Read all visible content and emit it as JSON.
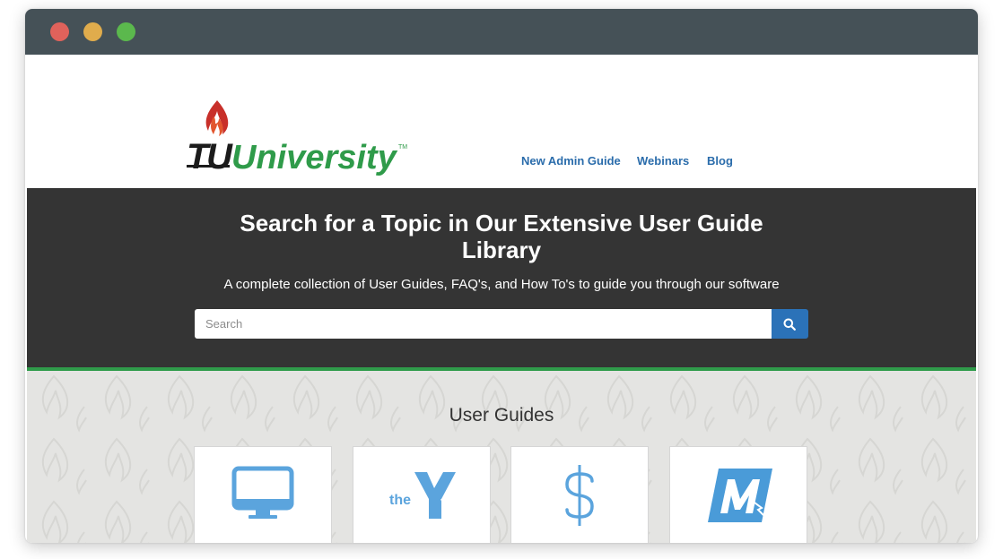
{
  "browser": {
    "buttons": [
      "close",
      "minimize",
      "maximize"
    ]
  },
  "header": {
    "logo_text": "TU University",
    "logo_tm": "TM",
    "nav": [
      {
        "label": "New Admin Guide"
      },
      {
        "label": "Webinars"
      },
      {
        "label": "Blog"
      }
    ]
  },
  "hero": {
    "title_line1": "Search for a Topic in Our Extensive User Guide",
    "title_line2": "Library",
    "subtitle": "A complete collection of User Guides, FAQ's, and How To's to guide you through our software",
    "search_placeholder": "Search",
    "search_icon": "search-icon"
  },
  "user_guides": {
    "title": "User Guides",
    "cards": [
      {
        "icon": "monitor-icon"
      },
      {
        "icon": "ymca-logo-icon",
        "text": "the"
      },
      {
        "icon": "dollar-icon"
      },
      {
        "icon": "m-logo-icon"
      }
    ]
  },
  "colors": {
    "titlebar": "#455157",
    "hero_bg": "#343434",
    "accent_green": "#2f9b4a",
    "link_blue": "#2a6cab",
    "button_blue": "#2b72b8",
    "icon_blue": "#5ba4dd"
  }
}
